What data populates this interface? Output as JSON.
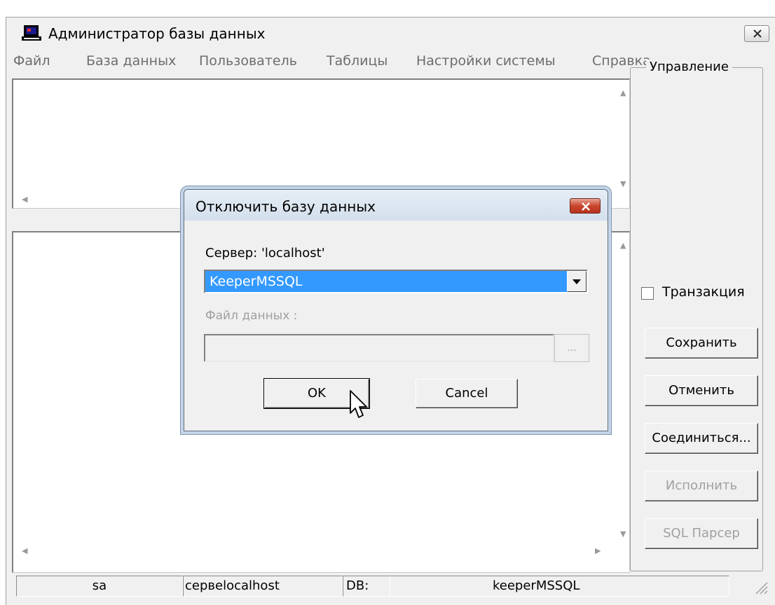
{
  "window": {
    "title": "Администратор базы данных"
  },
  "menu": [
    "Файл",
    "База данных",
    "Пользователь",
    "Таблицы",
    "Настройки системы",
    "Справка"
  ],
  "control_panel": {
    "group_label": "Управление",
    "transaction_label": "Транзакция",
    "transaction_checked": false,
    "buttons": [
      {
        "label": "Сохранить",
        "enabled": true
      },
      {
        "label": "Отменить",
        "enabled": true
      },
      {
        "label": "Соединиться...",
        "enabled": true
      },
      {
        "label": "Исполнить",
        "enabled": false
      },
      {
        "label": "SQL Парсер",
        "enabled": false
      }
    ]
  },
  "statusbar": {
    "user": "sa",
    "server": "сервеlocalhost",
    "db_label": "DB:",
    "db_name": "keeperMSSQL"
  },
  "dialog": {
    "title": "Отключить базу данных",
    "server_label": "Сервер: 'localhost'",
    "selected_db": "KeeperMSSQL",
    "datafile_label": "Файл данных :",
    "datafile_value": "",
    "browse_label": "...",
    "ok_label": "OK",
    "cancel_label": "Cancel"
  },
  "colors": {
    "selection": "#3399ff",
    "dialog_close": "#c9462e",
    "disabled_text": "#a0a0a0"
  }
}
